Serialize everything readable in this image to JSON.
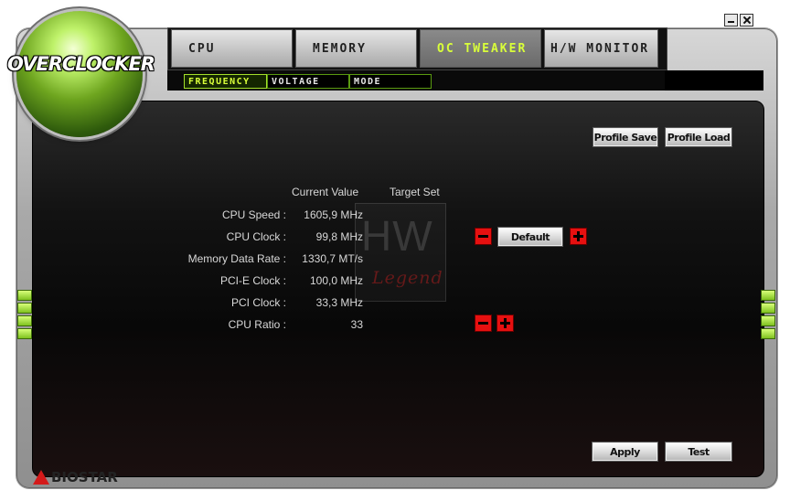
{
  "app": {
    "title": "OVERCLOCKER",
    "brand": "BIOSTAR"
  },
  "tabs": [
    {
      "label": "CPU",
      "active": false
    },
    {
      "label": "MEMORY",
      "active": false
    },
    {
      "label": "OC TWEAKER",
      "active": true
    },
    {
      "label": "H/W MONITOR",
      "active": false
    }
  ],
  "subtabs": [
    {
      "label": "FREQUENCY",
      "active": true
    },
    {
      "label": "VOLTAGE",
      "active": false
    },
    {
      "label": "MODE",
      "active": false
    }
  ],
  "buttons": {
    "profile_save": "Profile Save",
    "profile_load": "Profile Load",
    "default": "Default",
    "apply": "Apply",
    "test": "Test"
  },
  "table": {
    "headers": {
      "current": "Current Value",
      "target": "Target Set"
    },
    "rows": [
      {
        "label": "CPU Speed :",
        "current": "1605,9 MHz"
      },
      {
        "label": "CPU Clock :",
        "current": "99,8 MHz"
      },
      {
        "label": "Memory Data Rate :",
        "current": "1330,7 MT/s"
      },
      {
        "label": "PCI-E Clock :",
        "current": "100,0 MHz"
      },
      {
        "label": "PCI Clock :",
        "current": "33,3 MHz"
      },
      {
        "label": "CPU Ratio :",
        "current": "33"
      }
    ]
  },
  "watermark": {
    "top": "HW",
    "bottom": "Legend"
  },
  "icons": {
    "minimize": "minimize-icon",
    "close": "close-icon",
    "minus": "minus-icon",
    "plus": "plus-icon",
    "brand": "biostar-logo-icon"
  },
  "colors": {
    "accent_green": "#d9ff3a",
    "control_red": "#e61010",
    "panel_dark": "#121212"
  }
}
